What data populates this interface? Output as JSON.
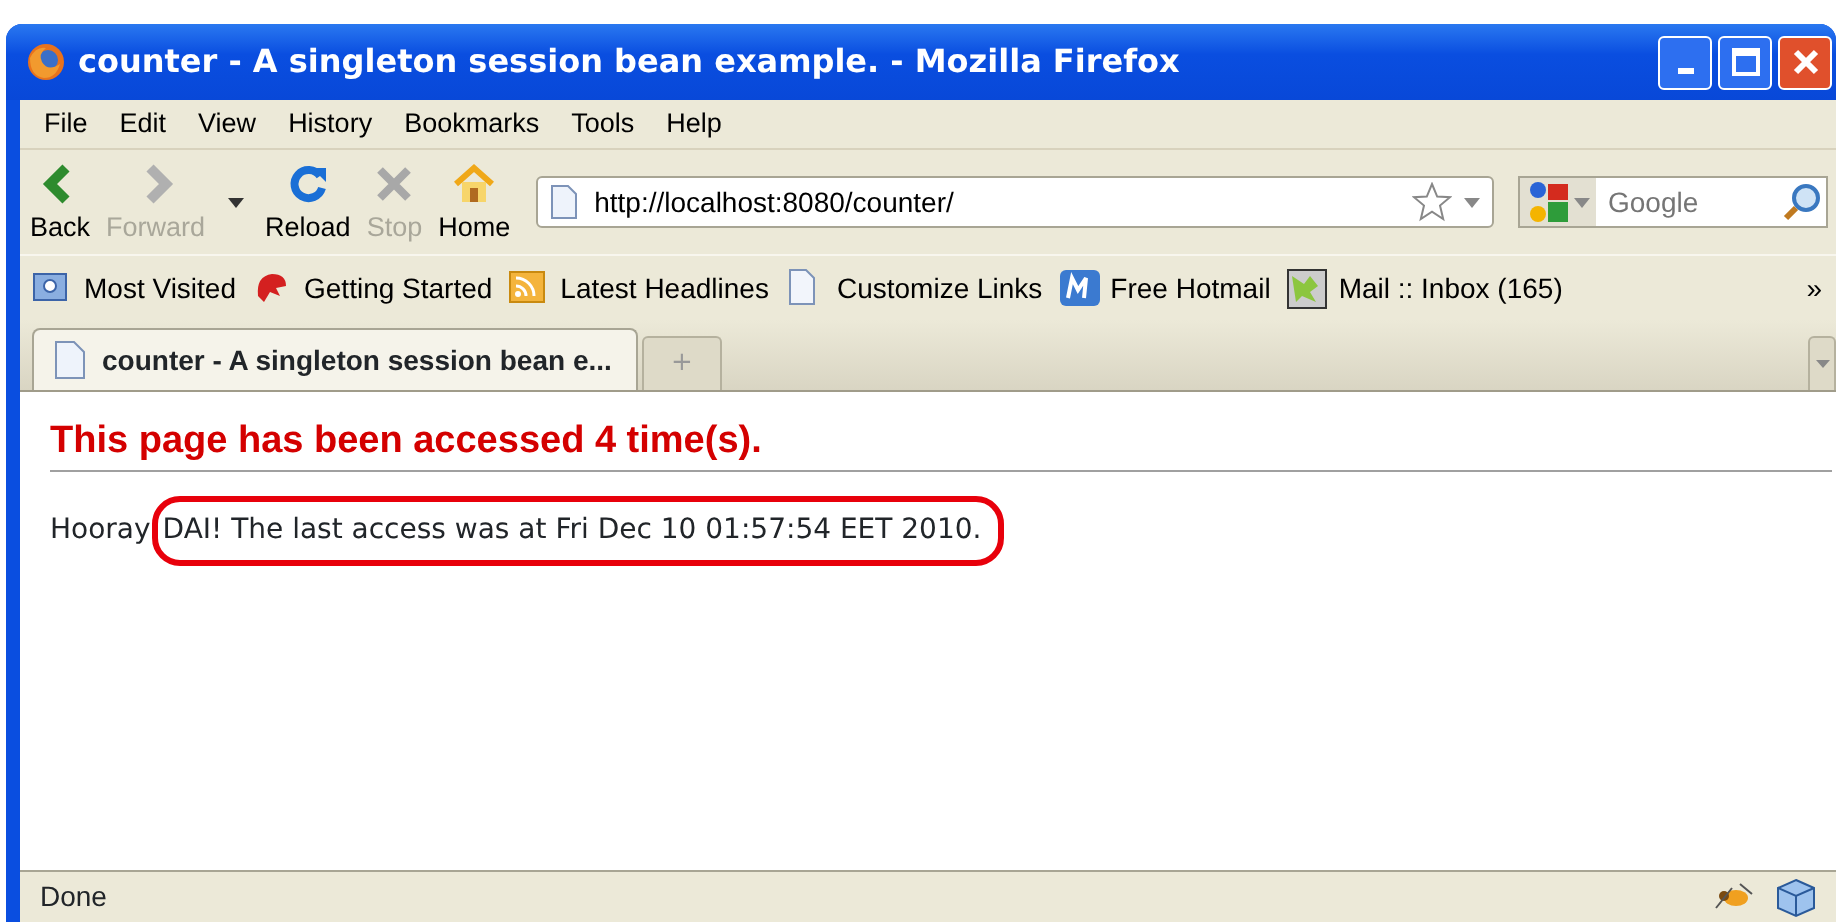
{
  "window": {
    "title": "counter - A singleton session bean example. - Mozilla Firefox"
  },
  "menu": [
    "File",
    "Edit",
    "View",
    "History",
    "Bookmarks",
    "Tools",
    "Help"
  ],
  "nav_buttons": [
    {
      "kind": "back",
      "label": "Back",
      "disabled": false
    },
    {
      "kind": "forward",
      "label": "Forward",
      "disabled": true
    },
    {
      "kind": "dropdown"
    },
    {
      "kind": "reload",
      "label": "Reload",
      "disabled": false
    },
    {
      "kind": "stop",
      "label": "Stop",
      "disabled": true
    },
    {
      "kind": "home",
      "label": "Home",
      "disabled": false
    }
  ],
  "address": {
    "value": "http://localhost:8080/counter/"
  },
  "search": {
    "placeholder": "Google"
  },
  "bookmarks": [
    {
      "kind": "smart",
      "label": "Most Visited"
    },
    {
      "kind": "dino",
      "label": "Getting Started"
    },
    {
      "kind": "feed",
      "label": "Latest Headlines"
    },
    {
      "kind": "page",
      "label": "Customize Links"
    },
    {
      "kind": "hotmail",
      "label": "Free Hotmail"
    },
    {
      "kind": "map",
      "label": "Mail :: Inbox (165)"
    }
  ],
  "bookmarks_overflow": "»",
  "tabs": [
    {
      "label": "counter - A singleton session bean e...",
      "selected": true
    }
  ],
  "new_tab": "+",
  "page": {
    "heading": "This page has been accessed 4 time(s).",
    "lead": "Hooray",
    "message": "DAI! The last access was at Fri Dec 10 01:57:54 EET 2010."
  },
  "status_bar": {
    "text": "Done"
  }
}
